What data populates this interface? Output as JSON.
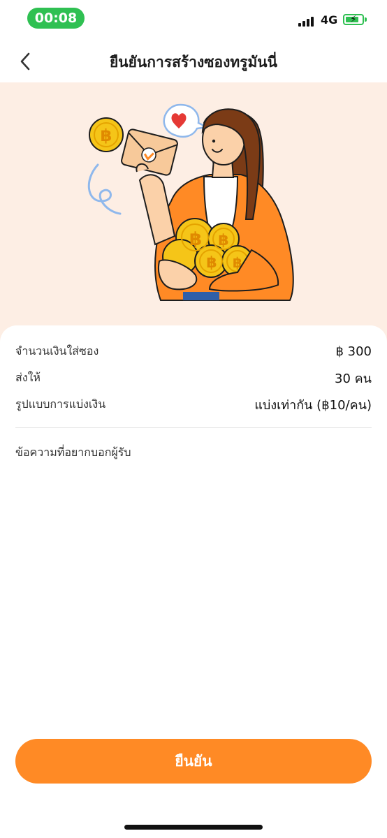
{
  "status_bar": {
    "time": "00:08",
    "network": "4G",
    "battery_bolt": "⚡"
  },
  "nav": {
    "title": "ยืนยันการสร้างซองทรูมันนี่",
    "back_icon": "chevron-left-icon"
  },
  "colors": {
    "accent": "#ff8a25",
    "hero_bg": "#fdeee4",
    "status_green": "#2fc052",
    "coin": "#f5c518"
  },
  "details": [
    {
      "label": "จำนวนเงินใส่ซอง",
      "value": "฿ 300"
    },
    {
      "label": "ส่งให้",
      "value": "30 คน"
    },
    {
      "label": "รูปแบบการแบ่งเงิน",
      "value": "แบ่งเท่ากัน (฿10/คน)"
    }
  ],
  "message_label": "ข้อความที่อยากบอกผู้รับ",
  "illustration": {
    "coin_symbol": "฿"
  },
  "confirm_label": "ยืนยัน"
}
